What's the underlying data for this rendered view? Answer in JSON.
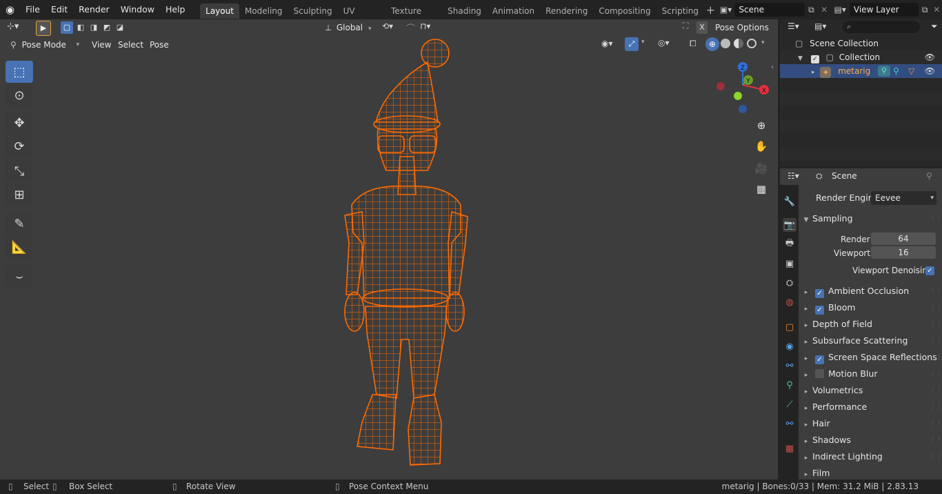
{
  "topbar": {
    "menus": [
      "File",
      "Edit",
      "Render",
      "Window",
      "Help"
    ],
    "workspaces": [
      "Layout",
      "Modeling",
      "Sculpting",
      "UV Editing",
      "Texture Paint",
      "Shading",
      "Animation",
      "Rendering",
      "Compositing",
      "Scripting"
    ],
    "active_workspace": "Layout",
    "scene_name": "Scene",
    "view_layer": "View Layer"
  },
  "viewport": {
    "transform_orientation": "Global",
    "pose_options": "Pose Options",
    "mode": "Pose Mode",
    "header_menus": [
      "View",
      "Select",
      "Pose"
    ],
    "x_mirror": "X",
    "gizmo_axes": {
      "x": "X",
      "y": "Y",
      "z": "Z"
    },
    "mesh_color": "#ff6a00"
  },
  "outliner": {
    "root": "Scene Collection",
    "collection": "Collection",
    "object": "metarig"
  },
  "properties": {
    "context": "Scene",
    "render_engine_label": "Render Engine",
    "render_engine": "Eevee",
    "sampling_label": "Sampling",
    "render_label": "Render",
    "render_samples": "64",
    "viewport_label": "Viewport",
    "viewport_samples": "16",
    "viewport_denoising": "Viewport Denoising",
    "panels": [
      {
        "label": "Ambient Occlusion",
        "checkbox": "on"
      },
      {
        "label": "Bloom",
        "checkbox": "on"
      },
      {
        "label": "Depth of Field",
        "checkbox": "none"
      },
      {
        "label": "Subsurface Scattering",
        "checkbox": "none"
      },
      {
        "label": "Screen Space Reflections",
        "checkbox": "on"
      },
      {
        "label": "Motion Blur",
        "checkbox": "off"
      },
      {
        "label": "Volumetrics",
        "checkbox": "none"
      },
      {
        "label": "Performance",
        "checkbox": "none"
      },
      {
        "label": "Hair",
        "checkbox": "none"
      },
      {
        "label": "Shadows",
        "checkbox": "none"
      },
      {
        "label": "Indirect Lighting",
        "checkbox": "none"
      },
      {
        "label": "Film",
        "checkbox": "none"
      }
    ]
  },
  "status": {
    "select": "Select",
    "box_select": "Box Select",
    "rotate_view": "Rotate View",
    "context_menu": "Pose Context Menu",
    "info": "metarig | Bones:0/33 | Mem: 31.2 MiB | 2.83.13"
  }
}
